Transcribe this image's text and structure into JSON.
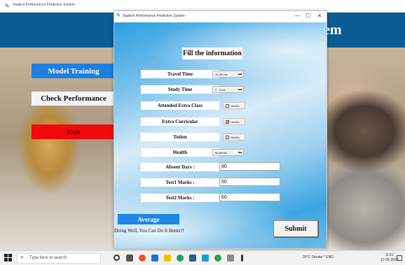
{
  "background_window": {
    "title": "Student Performance Prediction System",
    "header_title": "em",
    "buttons": {
      "model_training": "Model Training",
      "check_performance": "Check Performance",
      "exit": "Exit"
    }
  },
  "dialog": {
    "title": "Student Performance Prediction System",
    "controls": {
      "minimize": "—",
      "maximize": "☐",
      "close": "✕"
    },
    "heading": "Fill the information",
    "fields": {
      "travel_time": {
        "label": "Travel Time",
        "value": "15-30 min"
      },
      "study_time": {
        "label": "Study Time",
        "value": "2 - 5 hrs"
      },
      "extra_class": {
        "label": "Attended Extra Class",
        "option": "Yes/No",
        "checked": false
      },
      "extra_curricular": {
        "label": "Extra Curricular",
        "option": "Yes/No",
        "checked": true
      },
      "tution": {
        "label": "Tution",
        "option": "Yes/No",
        "checked": false
      },
      "health": {
        "label": "Health",
        "value": "Moderate"
      },
      "absent_days": {
        "label": "Absent Days :",
        "value": "80"
      },
      "test1_marks": {
        "label": "Test1 Marks :",
        "value": "50"
      },
      "test2_marks": {
        "label": "Test2 Marks :",
        "value": "60"
      }
    },
    "average_label": "Average",
    "result_text": "Doing Well, You Can Do It Better!!",
    "submit_label": "Submit",
    "check_mark": "✔"
  },
  "taskbar": {
    "search_placeholder": "Type here to search",
    "tray_text": "30°C Smoke  ^  ENG",
    "time": "11:52",
    "date": "17-05-2022"
  },
  "icons": {
    "app": "feather-icon",
    "search": "search-icon",
    "dropdown": "chevron-down-icon"
  }
}
